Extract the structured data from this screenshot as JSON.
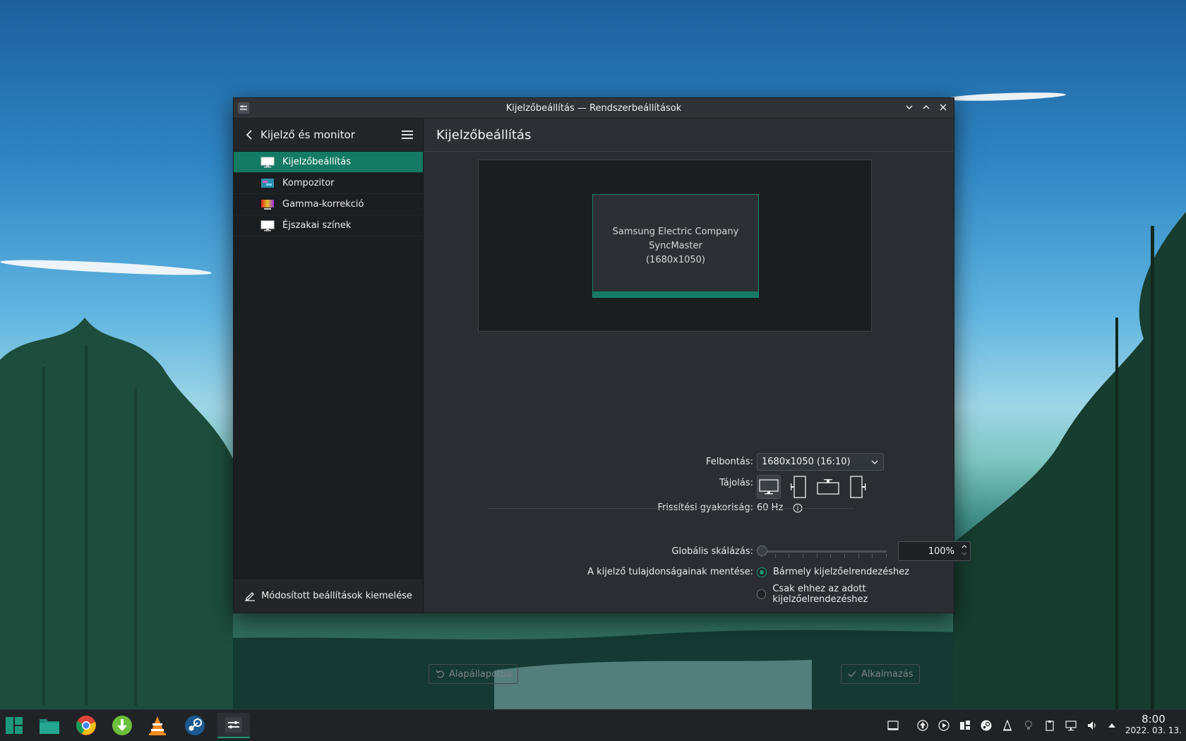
{
  "window": {
    "title": "Kijelzőbeállítás — Rendszerbeállítások"
  },
  "sidebar": {
    "header_title": "Kijelző és monitor",
    "items": [
      {
        "label": "Kijelzőbeállítás",
        "icon": "monitor-icon",
        "active": true
      },
      {
        "label": "Kompozitor",
        "icon": "compositor-icon",
        "active": false
      },
      {
        "label": "Gamma-korrekció",
        "icon": "gamma-icon",
        "active": false
      },
      {
        "label": "Éjszakai színek",
        "icon": "night-color-icon",
        "active": false
      }
    ],
    "footer_label": "Módosított beállítások kiemelése"
  },
  "main": {
    "title": "Kijelzőbeállítás",
    "monitor_name": "Samsung Electric Company SyncMaster",
    "monitor_resolution": "(1680x1050)",
    "resolution_label": "Felbontás:",
    "resolution_value": "1680x1050 (16:10)",
    "orientation_label": "Tájolás:",
    "refresh_label": "Frissítési gyakoriság:",
    "refresh_value": "60 Hz",
    "scale_label": "Globális skálázás:",
    "scale_value": "100%",
    "scale_level_percent": 0,
    "save_label": "A kijelző tulajdonságainak mentése:",
    "save_options": [
      {
        "label": "Bármely kijelzőelrendezéshez",
        "selected": true
      },
      {
        "label": "Csak ehhez az adott kijelzőelrendezéshez",
        "selected": false
      }
    ],
    "reset_button": "Alapállapotba",
    "apply_button": "Alkalmazás"
  },
  "taskbar": {
    "time": "8:00",
    "date": "2022. 03. 13."
  },
  "colors": {
    "accent": "#147a64",
    "window_bg": "#2a2e32",
    "sidebar_bg": "#1b1e20"
  }
}
